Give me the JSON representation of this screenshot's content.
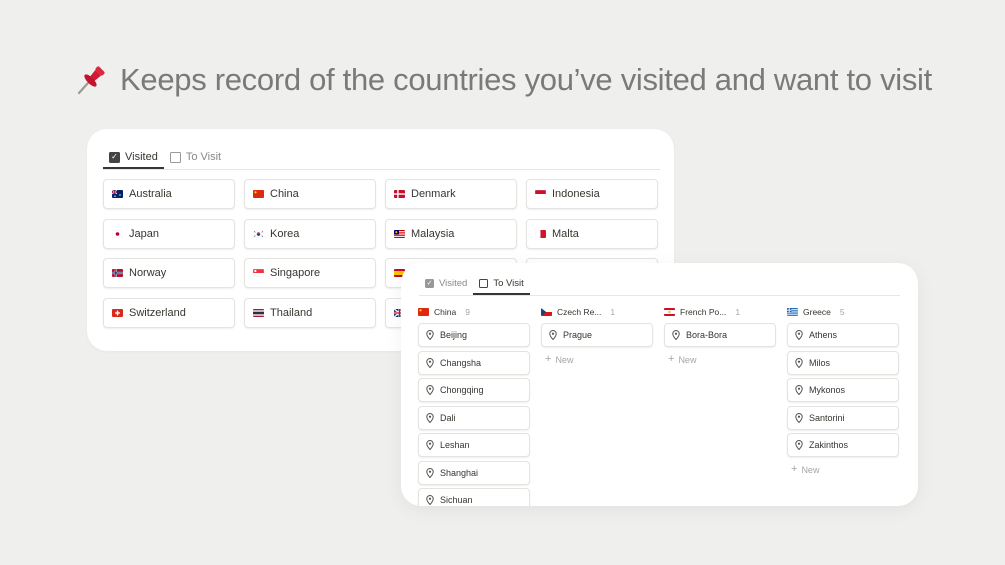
{
  "headline": {
    "text": "Keeps record of the countries you’ve visited and want to visit"
  },
  "visited_view": {
    "tabs": [
      {
        "label": "Visited",
        "checked": true,
        "active": true
      },
      {
        "label": "To Visit",
        "checked": false,
        "active": false
      }
    ],
    "countries": [
      {
        "name": "Australia",
        "flag": "australia"
      },
      {
        "name": "China",
        "flag": "china"
      },
      {
        "name": "Denmark",
        "flag": "denmark"
      },
      {
        "name": "Indonesia",
        "flag": "indonesia"
      },
      {
        "name": "Japan",
        "flag": "japan"
      },
      {
        "name": "Korea",
        "flag": "korea"
      },
      {
        "name": "Malaysia",
        "flag": "malaysia"
      },
      {
        "name": "Malta",
        "flag": "malta"
      },
      {
        "name": "Norway",
        "flag": "norway"
      },
      {
        "name": "Singapore",
        "flag": "singapore"
      },
      {
        "name": "",
        "flag": "spain"
      },
      {
        "name": "",
        "flag": ""
      },
      {
        "name": "Switzerland",
        "flag": "switzerland"
      },
      {
        "name": "Thailand",
        "flag": "thailand"
      },
      {
        "name": "",
        "flag": "uk"
      },
      {
        "name": "",
        "flag": ""
      }
    ]
  },
  "to_visit_view": {
    "tabs": [
      {
        "label": "Visited",
        "checked": true,
        "active": false
      },
      {
        "label": "To Visit",
        "checked": false,
        "active": true
      }
    ],
    "new_label": "New",
    "columns": [
      {
        "name": "China",
        "count": "9",
        "flag": "china",
        "items": [
          "Beijing",
          "Changsha",
          "Chongqing",
          "Dali",
          "Leshan",
          "Shanghai",
          "Sichuan"
        ],
        "show_new": false
      },
      {
        "name": "Czech Re...",
        "count": "1",
        "flag": "czech",
        "items": [
          "Prague"
        ],
        "show_new": true
      },
      {
        "name": "French Po...",
        "count": "1",
        "flag": "french-polynesia",
        "items": [
          "Bora-Bora"
        ],
        "show_new": true
      },
      {
        "name": "Greece",
        "count": "5",
        "flag": "greece",
        "items": [
          "Athens",
          "Milos",
          "Mykonos",
          "Santorini",
          "Zakinthos"
        ],
        "show_new": true
      }
    ]
  }
}
